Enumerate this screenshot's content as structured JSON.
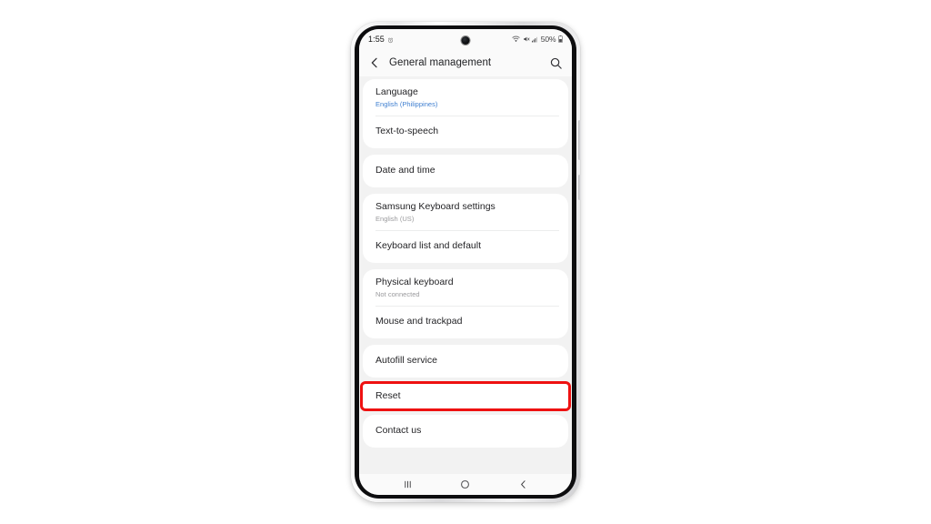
{
  "device": {
    "type": "smartphone",
    "frame_color": "#e2e2e4"
  },
  "status_bar": {
    "time": "1:55",
    "alarm_icon": "alarm-icon",
    "wifi_icon": "wifi-icon",
    "signal_icon": "cellular-signal-icon",
    "mute_icon": "sound-off-icon",
    "battery_percent": "50%",
    "battery_icon": "battery-icon"
  },
  "app_bar": {
    "back_icon": "back-chevron-icon",
    "title": "General management",
    "search_icon": "search-icon"
  },
  "groups": [
    {
      "id": "group-language",
      "items": [
        {
          "title": "Language",
          "subtitle": "English (Philippines)",
          "subtitle_style": "accent"
        },
        {
          "title": "Text-to-speech",
          "subtitle": "",
          "subtitle_style": "none"
        }
      ]
    },
    {
      "id": "group-date-time",
      "items": [
        {
          "title": "Date and time",
          "subtitle": "",
          "subtitle_style": "none"
        }
      ]
    },
    {
      "id": "group-keyboard",
      "items": [
        {
          "title": "Samsung Keyboard settings",
          "subtitle": "English (US)",
          "subtitle_style": "muted"
        },
        {
          "title": "Keyboard list and default",
          "subtitle": "",
          "subtitle_style": "none"
        }
      ]
    },
    {
      "id": "group-input-devices",
      "items": [
        {
          "title": "Physical keyboard",
          "subtitle": "Not connected",
          "subtitle_style": "muted"
        },
        {
          "title": "Mouse and trackpad",
          "subtitle": "",
          "subtitle_style": "none"
        }
      ]
    },
    {
      "id": "group-autofill",
      "items": [
        {
          "title": "Autofill service",
          "subtitle": "",
          "subtitle_style": "none"
        }
      ]
    },
    {
      "id": "group-reset",
      "highlighted": true,
      "highlight_color": "#ee1111",
      "items": [
        {
          "title": "Reset",
          "subtitle": "",
          "subtitle_style": "none"
        }
      ]
    },
    {
      "id": "group-contact",
      "items": [
        {
          "title": "Contact us",
          "subtitle": "",
          "subtitle_style": "none"
        }
      ]
    }
  ],
  "nav_bar": {
    "recents_icon": "recents-icon",
    "home_icon": "home-icon",
    "back_icon": "back-icon"
  }
}
